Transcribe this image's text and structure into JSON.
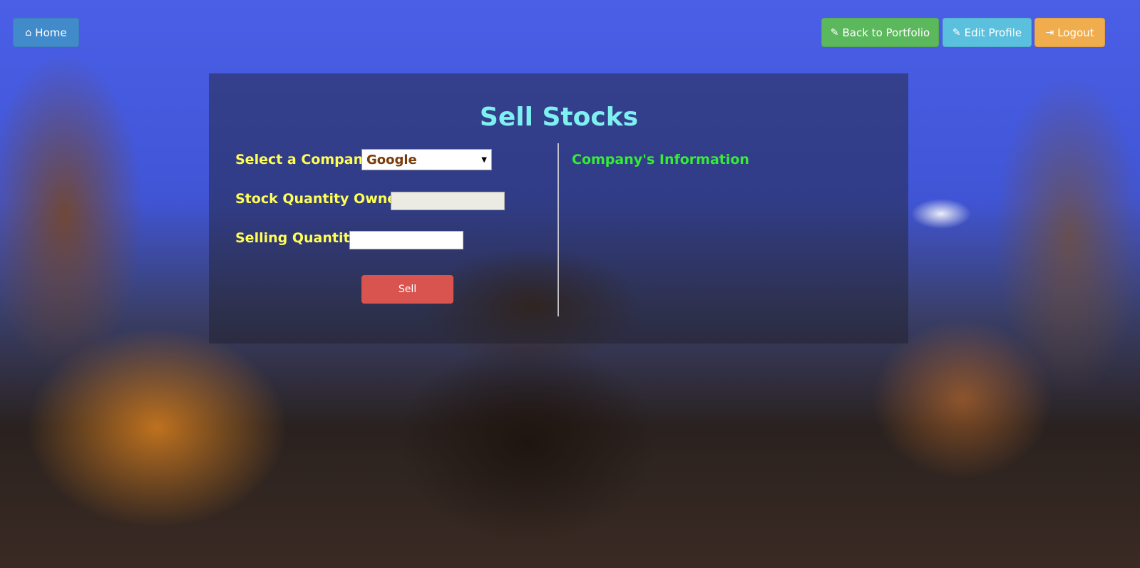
{
  "nav": {
    "home": {
      "label": "Home",
      "icon": "home-icon"
    },
    "back_to_portfolio": {
      "label": "Back to Portfolio",
      "icon": "edit-icon"
    },
    "edit_profile": {
      "label": "Edit Profile",
      "icon": "edit-icon"
    },
    "logout": {
      "label": "Logout",
      "icon": "logout-icon"
    }
  },
  "page": {
    "title": "Sell Stocks"
  },
  "form": {
    "company_label": "Select a Company:",
    "company_selected": "Google",
    "owned_label": "Stock Quantity Owned:",
    "owned_value": "",
    "selling_label": "Selling Quantity:",
    "selling_value": "",
    "sell_label": "Sell"
  },
  "info": {
    "heading": "Company's Information"
  },
  "colors": {
    "home_button": "#428bca",
    "portfolio_button": "#5cb85c",
    "profile_button": "#5bc0de",
    "logout_button": "#f0ad4e",
    "sell_button": "#d9534f",
    "title": "#7ff0f0",
    "labels": "#ffff55",
    "info_heading": "#33ee33"
  }
}
